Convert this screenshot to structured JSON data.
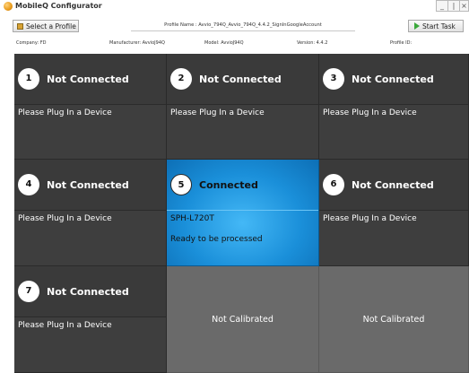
{
  "window": {
    "title": "MobileQ Configurator",
    "controls": [
      "_",
      "|",
      "×"
    ]
  },
  "toolbar": {
    "select_profile_label": "Select a Profile",
    "profile_name": "Profile Name : Avvio_794Q_Avvio_794Q_4.4.2_SignInGoogleAccount",
    "start_task_label": "Start Task"
  },
  "info": {
    "company": "Company: FD",
    "manufacturer": "Manufacturer: AvvioJ94Q",
    "model": "Model: AvvioJ94Q",
    "version": "Version: 4.4.2",
    "profile_id": "Profile ID:"
  },
  "slots": [
    {
      "number": "1",
      "status": "Not Connected",
      "message": "Please Plug In a Device"
    },
    {
      "number": "2",
      "status": "Not Connected",
      "message": "Please Plug In a Device"
    },
    {
      "number": "3",
      "status": "Not Connected",
      "message": "Please Plug In a Device"
    },
    {
      "number": "4",
      "status": "Not Connected",
      "message": "Please Plug In a Device"
    },
    {
      "number": "5",
      "status": "Connected",
      "message": "SPH-L720T",
      "message2": "Ready to be processed"
    },
    {
      "number": "6",
      "status": "Not Connected",
      "message": "Please Plug In a Device"
    },
    {
      "number": "7",
      "status": "Not Connected",
      "message": "Please Plug In a Device"
    }
  ],
  "uncalibrated": [
    {
      "label": "Not Calibrated"
    },
    {
      "label": "Not Calibrated"
    }
  ],
  "colors": {
    "cell_dark": "#3e3e3e",
    "connected_blue": "#1a8fd9",
    "uncalibrated_gray": "#6a6a6a",
    "start_icon_green": "#3aa83a"
  }
}
